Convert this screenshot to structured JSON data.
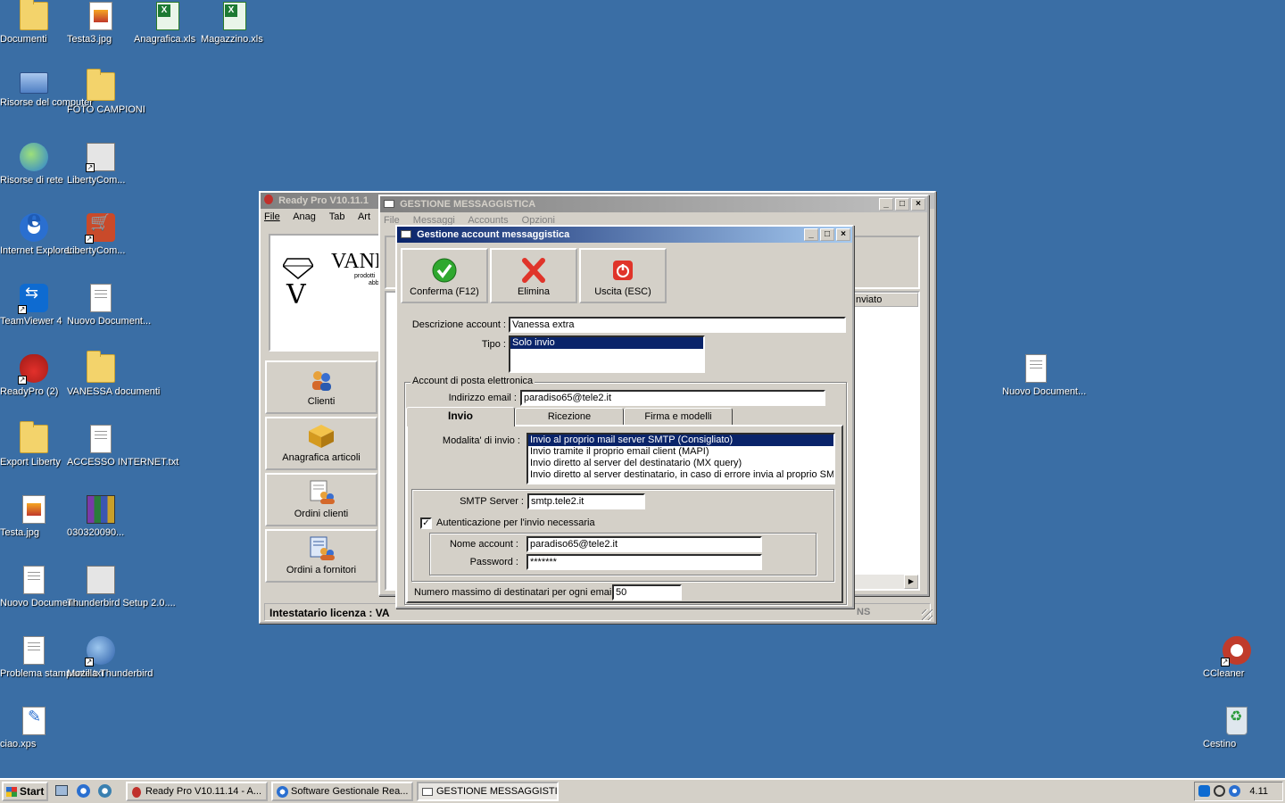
{
  "desktop": {
    "icons_left": [
      {
        "label": "Documenti",
        "type": "folder"
      },
      {
        "label": "Testa3.jpg",
        "type": "jpg"
      },
      {
        "label": "Anagrafica.xls",
        "type": "xls"
      },
      {
        "label": "Magazzino.xls",
        "type": "xls"
      },
      {
        "label": "Risorse del computer",
        "type": "computer"
      },
      {
        "label": "FOTO CAMPIONI",
        "type": "folder"
      },
      {
        "label": "Risorse di rete",
        "type": "network"
      },
      {
        "label": "LibertyCom...",
        "type": "setup"
      },
      {
        "label": "Internet Explorer",
        "type": "ie"
      },
      {
        "label": "LibertyCom...",
        "type": "cart"
      },
      {
        "label": "TeamViewer 4",
        "type": "teamviewer"
      },
      {
        "label": "Nuovo Document...",
        "type": "doc"
      },
      {
        "label": "ReadyPro (2)",
        "type": "strawberry"
      },
      {
        "label": "VANESSA documenti",
        "type": "folder"
      },
      {
        "label": "Export Liberty",
        "type": "folder"
      },
      {
        "label": "ACCESSO INTERNET.txt",
        "type": "doc"
      },
      {
        "label": "Testa.jpg",
        "type": "jpg"
      },
      {
        "label": "030320090...",
        "type": "rar"
      },
      {
        "label": "Nuovo Document...",
        "type": "doc"
      },
      {
        "label": "Thunderbird Setup 2.0....",
        "type": "thunderbird"
      },
      {
        "label": "Problema stampante.txt",
        "type": "doc"
      },
      {
        "label": "Mozilla Thunderbird",
        "type": "mozilla"
      },
      {
        "label": "ciao.xps",
        "type": "xps"
      }
    ],
    "icons_right": [
      {
        "label": "Nuovo Document...",
        "type": "doc"
      },
      {
        "label": "CCleaner",
        "type": "ccleaner"
      },
      {
        "label": "Cestino",
        "type": "recycle-bin"
      }
    ]
  },
  "readypro": {
    "title": "Ready Pro V10.11.1",
    "menu": [
      "File",
      "Anag",
      "Tab",
      "Art"
    ],
    "logo_text": "VANE",
    "logo_sub1": "prodotti",
    "logo_sub2": "abb",
    "side_buttons": [
      "Clienti",
      "Anagrafica articoli",
      "Ordini clienti",
      "Ordini a fornitori"
    ],
    "license_label": "Intestatario licenza : VA",
    "list_col_header": "nviato",
    "status_tail": "NS"
  },
  "gestione": {
    "title": "GESTIONE MESSAGGISTICA",
    "menu": [
      "File",
      "Messaggi",
      "Accounts",
      "Opzioni"
    ]
  },
  "dialog": {
    "title": "Gestione account messaggistica",
    "toolbar": {
      "confirm": "Conferma (F12)",
      "delete": "Elimina",
      "exit": "Uscita (ESC)"
    },
    "description_label": "Descrizione account :",
    "description_value": "Vanessa extra",
    "type_label": "Tipo :",
    "type_options": [
      "Solo invio"
    ],
    "email_group_title": "Account di posta elettronica",
    "email_label": "Indirizzo email :",
    "email_value": "paradiso65@tele2.it",
    "tabs": [
      "Invio",
      "Ricezione",
      "Firma e modelli"
    ],
    "send_mode_label": "Modalita' di invio :",
    "send_modes": [
      "Invio al proprio mail server SMTP (Consigliato)",
      "Invio tramite il proprio email client (MAPI)",
      "Invio diretto al server del destinatario (MX query)",
      "Invio diretto al server destinatario, in caso di errore invia al proprio SMTP"
    ],
    "smtp_label": "SMTP Server :",
    "smtp_value": "smtp.tele2.it",
    "auth_label": "Autenticazione per l'invio necessaria",
    "auth_checked": true,
    "account_name_label": "Nome account :",
    "account_name_value": "paradiso65@tele2.it",
    "password_label": "Password :",
    "password_value": "*******",
    "max_recipients_label": "Numero massimo di destinatari per ogni email :",
    "max_recipients_value": "50"
  },
  "taskbar": {
    "start": "Start",
    "tasks": [
      "Ready Pro V10.11.14 - A...",
      "Software Gestionale Rea...",
      "GESTIONE MESSAGGISTI..."
    ],
    "clock": "4.11"
  },
  "colors": {
    "desktop": "#3a6ea5",
    "title_active": "#0a246a",
    "face": "#d4d0c8"
  }
}
